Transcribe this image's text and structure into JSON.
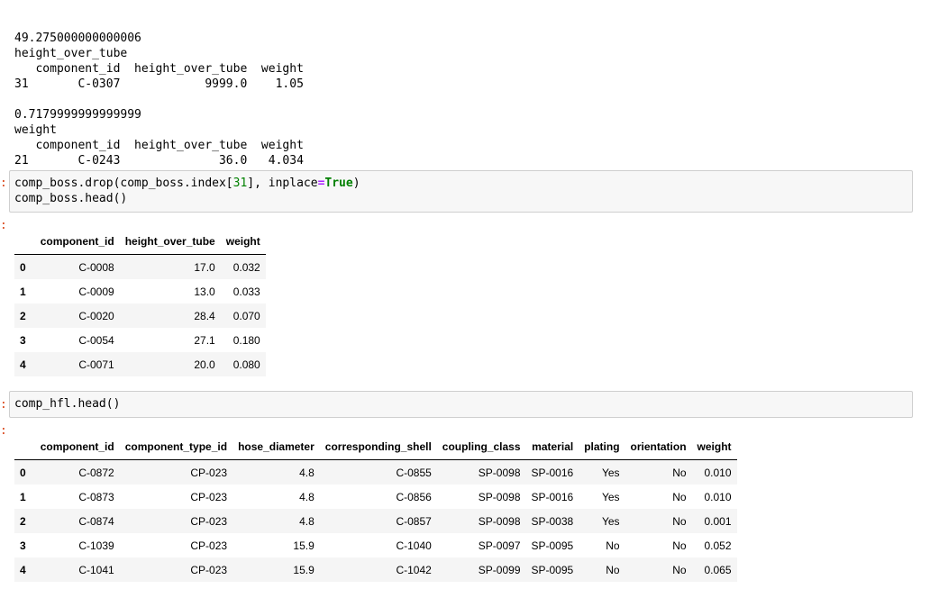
{
  "stdout": {
    "lines": [
      "49.275000000000006",
      "height_over_tube",
      "   component_id  height_over_tube  weight",
      "31       C-0307            9999.0    1.05",
      "",
      "0.7179999999999999",
      "weight",
      "   component_id  height_over_tube  weight",
      "21       C-0243              36.0   4.034"
    ]
  },
  "cell1": {
    "code_line1_a": "comp_boss.drop(comp_boss.index[",
    "code_line1_num": "31",
    "code_line1_b": "], inplace",
    "code_line1_op": "=",
    "code_line1_kw": "True",
    "code_line1_c": ")",
    "code_line2": "comp_boss.head()"
  },
  "table1": {
    "columns": [
      "",
      "component_id",
      "height_over_tube",
      "weight"
    ],
    "rows": [
      [
        "0",
        "C-0008",
        "17.0",
        "0.032"
      ],
      [
        "1",
        "C-0009",
        "13.0",
        "0.033"
      ],
      [
        "2",
        "C-0020",
        "28.4",
        "0.070"
      ],
      [
        "3",
        "C-0054",
        "27.1",
        "0.180"
      ],
      [
        "4",
        "C-0071",
        "20.0",
        "0.080"
      ]
    ]
  },
  "cell2": {
    "code_line1": "comp_hfl.head()"
  },
  "table2": {
    "columns": [
      "",
      "component_id",
      "component_type_id",
      "hose_diameter",
      "corresponding_shell",
      "coupling_class",
      "material",
      "plating",
      "orientation",
      "weight"
    ],
    "rows": [
      [
        "0",
        "C-0872",
        "CP-023",
        "4.8",
        "C-0855",
        "SP-0098",
        "SP-0016",
        "Yes",
        "No",
        "0.010"
      ],
      [
        "1",
        "C-0873",
        "CP-023",
        "4.8",
        "C-0856",
        "SP-0098",
        "SP-0016",
        "Yes",
        "No",
        "0.010"
      ],
      [
        "2",
        "C-0874",
        "CP-023",
        "4.8",
        "C-0857",
        "SP-0098",
        "SP-0038",
        "Yes",
        "No",
        "0.001"
      ],
      [
        "3",
        "C-1039",
        "CP-023",
        "15.9",
        "C-1040",
        "SP-0097",
        "SP-0095",
        "No",
        "No",
        "0.052"
      ],
      [
        "4",
        "C-1041",
        "CP-023",
        "15.9",
        "C-1042",
        "SP-0099",
        "SP-0095",
        "No",
        "No",
        "0.065"
      ]
    ]
  },
  "prompts": {
    "mark": ":"
  }
}
